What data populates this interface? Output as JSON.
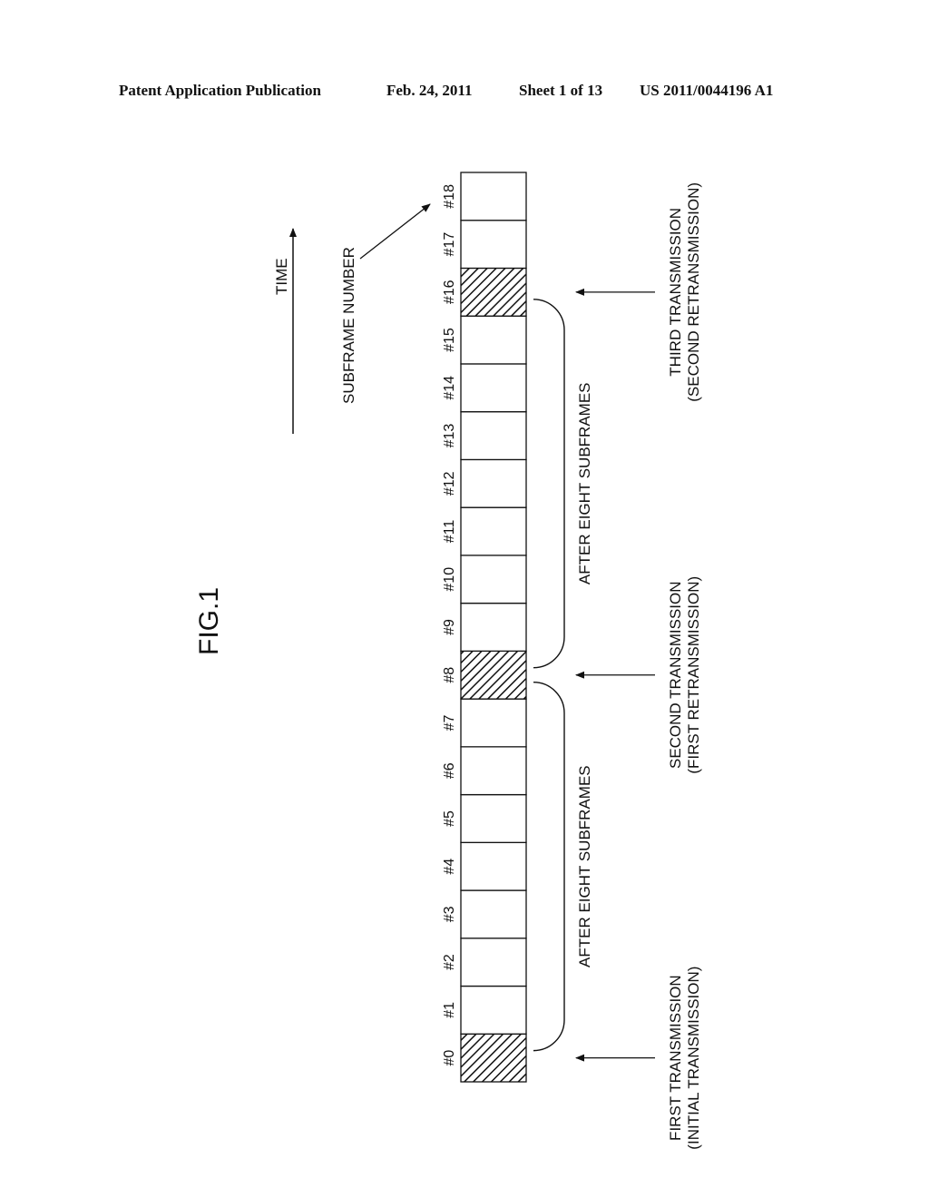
{
  "header": {
    "publication": "Patent Application Publication",
    "date": "Feb. 24, 2011",
    "sheet": "Sheet 1 of 13",
    "number": "US 2011/0044196 A1"
  },
  "figure": {
    "title": "FIG.1",
    "time_label": "TIME",
    "subframe_number_label": "SUBFRAME NUMBER",
    "subframes": [
      {
        "label": "#0",
        "transmission": true
      },
      {
        "label": "#1",
        "transmission": false
      },
      {
        "label": "#2",
        "transmission": false
      },
      {
        "label": "#3",
        "transmission": false
      },
      {
        "label": "#4",
        "transmission": false
      },
      {
        "label": "#5",
        "transmission": false
      },
      {
        "label": "#6",
        "transmission": false
      },
      {
        "label": "#7",
        "transmission": false
      },
      {
        "label": "#8",
        "transmission": true
      },
      {
        "label": "#9",
        "transmission": false
      },
      {
        "label": "#10",
        "transmission": false
      },
      {
        "label": "#11",
        "transmission": false
      },
      {
        "label": "#12",
        "transmission": false
      },
      {
        "label": "#13",
        "transmission": false
      },
      {
        "label": "#14",
        "transmission": false
      },
      {
        "label": "#15",
        "transmission": false
      },
      {
        "label": "#16",
        "transmission": true
      },
      {
        "label": "#17",
        "transmission": false
      },
      {
        "label": "#18",
        "transmission": false
      }
    ],
    "intervals": [
      {
        "label": "AFTER EIGHT SUBFRAMES",
        "from": 0,
        "to": 8
      },
      {
        "label": "AFTER EIGHT SUBFRAMES",
        "from": 8,
        "to": 16
      }
    ],
    "transmissions": [
      {
        "subframe": 0,
        "line1": "FIRST TRANSMISSION",
        "line2": "(INITIAL TRANSMISSION)"
      },
      {
        "subframe": 8,
        "line1": "SECOND TRANSMISSION",
        "line2": "(FIRST RETRANSMISSION)"
      },
      {
        "subframe": 16,
        "line1": "THIRD TRANSMISSION",
        "line2": "(SECOND RETRANSMISSION)"
      }
    ]
  }
}
